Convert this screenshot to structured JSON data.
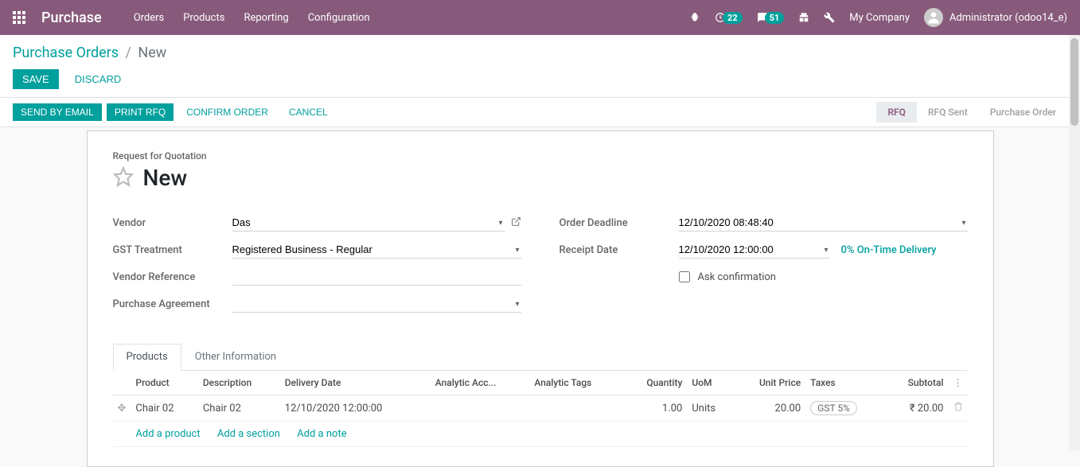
{
  "topnav": {
    "brand": "Purchase",
    "menu": [
      "Orders",
      "Products",
      "Reporting",
      "Configuration"
    ],
    "clock_badge": "22",
    "chat_badge": "51",
    "company": "My Company",
    "user": "Administrator (odoo14_e)"
  },
  "breadcrumb": {
    "root": "Purchase Orders",
    "current": "New"
  },
  "actions": {
    "save": "Save",
    "discard": "Discard"
  },
  "statusbar": {
    "send_email": "Send by Email",
    "print_rfq": "Print RFQ",
    "confirm": "Confirm Order",
    "cancel": "Cancel",
    "steps": {
      "rfq": "RFQ",
      "rfq_sent": "RFQ Sent",
      "po": "Purchase Order"
    }
  },
  "form": {
    "section_label": "Request for Quotation",
    "title": "New",
    "labels": {
      "vendor": "Vendor",
      "gst": "GST Treatment",
      "vendor_ref": "Vendor Reference",
      "agreement": "Purchase Agreement",
      "deadline": "Order Deadline",
      "receipt": "Receipt Date",
      "ask_confirm": "Ask confirmation"
    },
    "values": {
      "vendor": "Das",
      "gst": "Registered Business - Regular",
      "vendor_ref": "",
      "agreement": "",
      "deadline": "12/10/2020 08:48:40",
      "receipt": "12/10/2020 12:00:00",
      "on_time_link": "0% On-Time Delivery"
    }
  },
  "tabs": {
    "products": "Products",
    "other": "Other Information"
  },
  "table": {
    "headers": {
      "product": "Product",
      "description": "Description",
      "delivery": "Delivery Date",
      "analytic_acc": "Analytic Acc...",
      "analytic_tags": "Analytic Tags",
      "quantity": "Quantity",
      "uom": "UoM",
      "unit_price": "Unit Price",
      "taxes": "Taxes",
      "subtotal": "Subtotal"
    },
    "rows": [
      {
        "product": "Chair 02",
        "description": "Chair 02",
        "delivery": "12/10/2020 12:00:00",
        "analytic_acc": "",
        "analytic_tags": "",
        "quantity": "1.00",
        "uom": "Units",
        "unit_price": "20.00",
        "tax": "GST 5%",
        "subtotal": "₹ 20.00"
      }
    ],
    "add_product": "Add a product",
    "add_section": "Add a section",
    "add_note": "Add a note"
  }
}
